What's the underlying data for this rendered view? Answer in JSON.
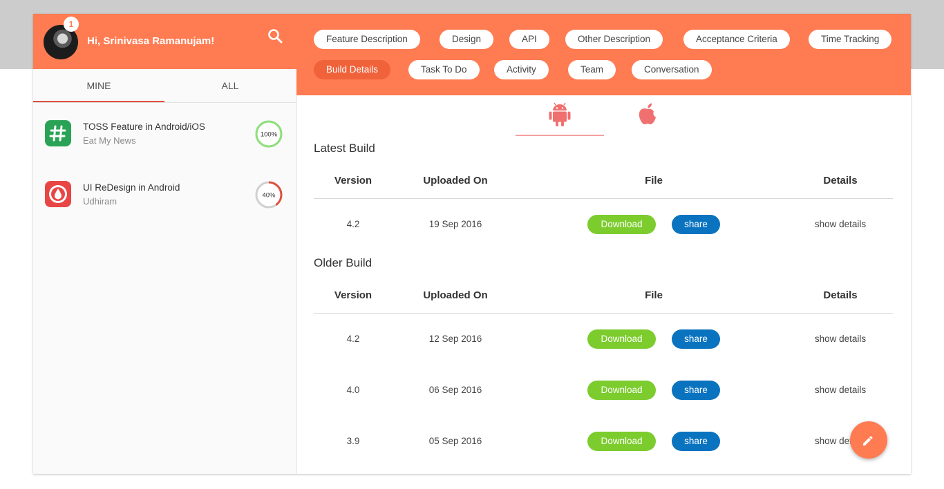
{
  "user": {
    "greeting": "Hi, Srinivasa Ramanujam!",
    "notifications": "1"
  },
  "sidebar": {
    "tabs": [
      {
        "label": "MINE"
      },
      {
        "label": "ALL"
      }
    ],
    "projects": [
      {
        "title": "TOSS Feature in Android/iOS",
        "subtitle": "Eat My News",
        "progress": "100%",
        "progress_value": 1.0,
        "color": "#8ee07a"
      },
      {
        "title": "UI ReDesign in Android",
        "subtitle": "Udhiram",
        "progress": "40%",
        "progress_value": 0.4,
        "color": "#e0503a"
      }
    ]
  },
  "nav": {
    "tabs": [
      {
        "label": "Feature Description"
      },
      {
        "label": "Design"
      },
      {
        "label": "API"
      },
      {
        "label": "Other Description"
      },
      {
        "label": "Acceptance Criteria"
      },
      {
        "label": "Time Tracking"
      },
      {
        "label": "Build Details"
      },
      {
        "label": "Task To Do"
      },
      {
        "label": "Activity"
      },
      {
        "label": "Team"
      },
      {
        "label": "Conversation"
      }
    ],
    "active": "Build Details"
  },
  "platforms": {
    "active": "android-icon",
    "items": [
      "android-icon",
      "apple-icon"
    ]
  },
  "table_headers": {
    "version": "Version",
    "uploaded": "Uploaded On",
    "file": "File",
    "details": "Details"
  },
  "latest": {
    "title": "Latest Build",
    "rows": [
      {
        "version": "4.2",
        "date": "19 Sep 2016",
        "download": "Download",
        "share": "share",
        "details": "show details"
      }
    ]
  },
  "older": {
    "title": "Older Build",
    "rows": [
      {
        "version": "4.2",
        "date": "12 Sep 2016",
        "download": "Download",
        "share": "share",
        "details": "show details"
      },
      {
        "version": "4.0",
        "date": "06 Sep 2016",
        "download": "Download",
        "share": "share",
        "details": "show details"
      },
      {
        "version": "3.9",
        "date": "05 Sep 2016",
        "download": "Download",
        "share": "share",
        "details": "show details"
      }
    ]
  },
  "colors": {
    "accent": "#ff7b52",
    "download": "#7ccc2e",
    "share": "#0a73c0",
    "apple": "#f07070"
  }
}
